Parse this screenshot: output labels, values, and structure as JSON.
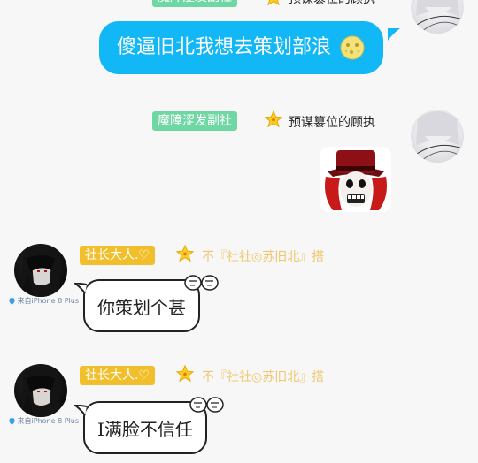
{
  "colors": {
    "accent_blue": "#12b7f5",
    "tag_green": "#6fd7a3",
    "tag_orange": "#f2bf2c",
    "gold_text": "#f0c76f"
  },
  "messages": [
    {
      "side": "right",
      "tag": "魔障涩发副社",
      "badge": "star-badge-icon",
      "title": "预谋篡位的顾执",
      "text": "傻逼旧北我想去策划部浪",
      "emoji": "moon-face-emoji-icon"
    },
    {
      "side": "right",
      "tag": "魔障涩发副社",
      "badge": "star-badge-icon",
      "title": "预谋篡位的顾执",
      "sticker": "red-hat-sticker"
    },
    {
      "side": "left",
      "tag": "社长大人.♡",
      "badge": "star-badge-icon",
      "title": "不『社社◎苏旧北』搭",
      "text": "你策划个甚",
      "location": "来自iPhone 8 Plus"
    },
    {
      "side": "left",
      "tag": "社长大人.♡",
      "badge": "star-badge-icon",
      "title": "不『社社◎苏旧北』搭",
      "text": "I满脸不信任",
      "location": "来自iPhone 8 Plus"
    }
  ]
}
